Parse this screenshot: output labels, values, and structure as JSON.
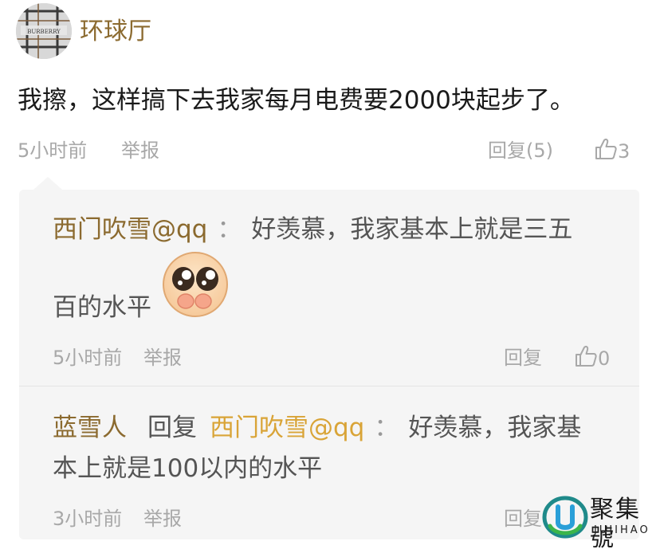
{
  "post": {
    "username": "环球厅",
    "avatar_brand": "BURBERRY",
    "text": "我擦，这样搞下去我家每月电费要2000块起步了。",
    "time": "5小时前",
    "report": "举报",
    "reply_label": "回复(5)",
    "like_count": "3"
  },
  "replies": [
    {
      "author": "西门吹雪@qq",
      "colon": "：",
      "line1": "好羡慕，我家基本上就是三五",
      "line2": "百的水平",
      "time": "5小时前",
      "report": "举报",
      "reply_label": "回复",
      "like_count": "0"
    },
    {
      "author": "蓝雪人",
      "reply_word": "回复",
      "target": "西门吹雪@qq",
      "colon": "：",
      "line1": "好羡慕，我家基",
      "line2": "本上就是100以内的水平",
      "time": "3小时前",
      "report": "举报",
      "reply_label": "回复"
    }
  ],
  "watermark": {
    "cn": "聚集號",
    "en": "JUJIHAO"
  },
  "colors": {
    "name": "#8b6a2f",
    "name_gold": "#d9a437",
    "meta": "#a8a8a8",
    "reply_bg": "#f5f5f5"
  }
}
